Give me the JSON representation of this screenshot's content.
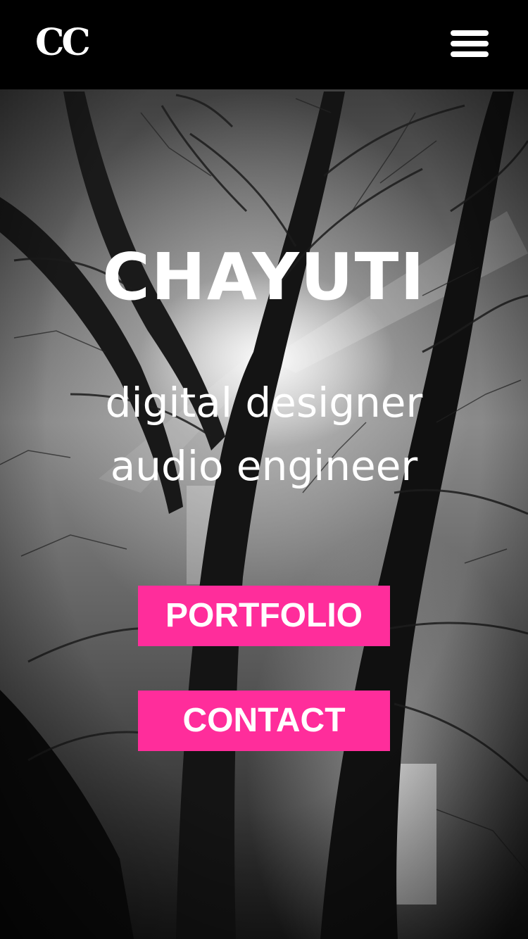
{
  "header": {
    "logo": "CC",
    "menu_icon": "hamburger-menu-icon"
  },
  "hero": {
    "name": "CHAYUTI",
    "tagline_line1": "digital designer",
    "tagline_line2": "audio engineer"
  },
  "actions": {
    "portfolio_label": "PORTFOLIO",
    "contact_label": "CONTACT"
  },
  "colors": {
    "accent": "#ff2d9b",
    "topbar": "#000000",
    "text": "#ffffff"
  }
}
